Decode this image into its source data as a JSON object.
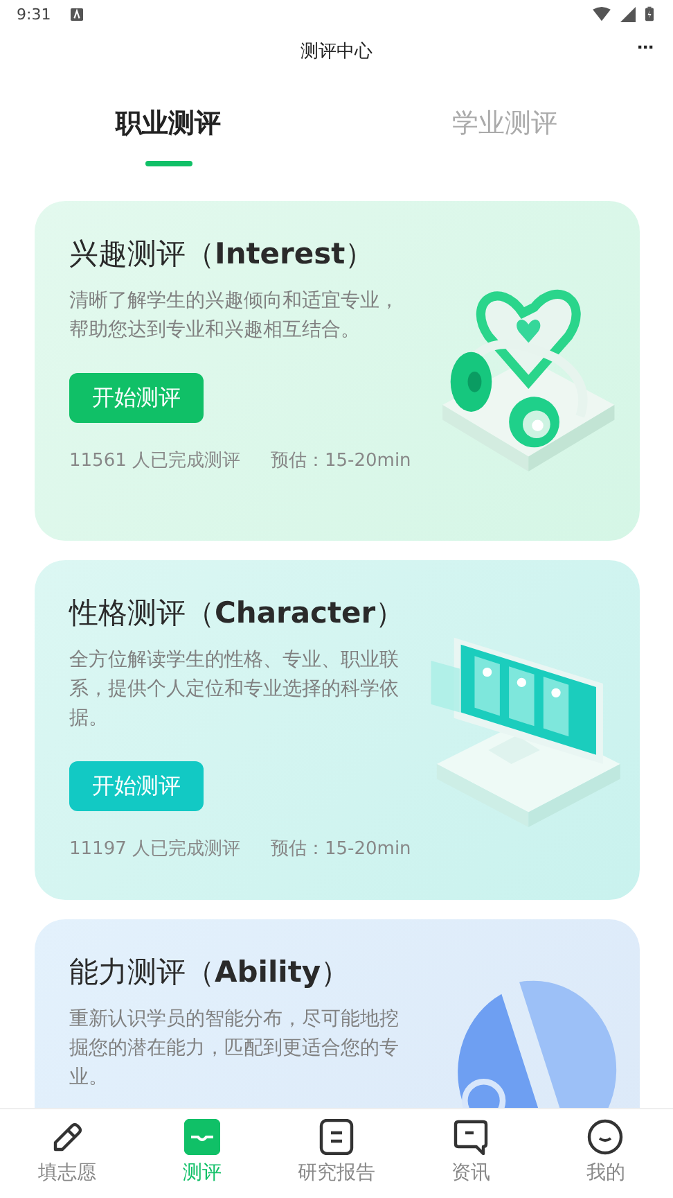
{
  "status_bar": {
    "time": "9:31"
  },
  "header": {
    "title": "测评中心",
    "more": "···"
  },
  "tabs": [
    {
      "label": "职业测评",
      "selected": true
    },
    {
      "label": "学业测评",
      "selected": false
    }
  ],
  "cards": [
    {
      "kind": "interest",
      "title": "兴趣测评（",
      "title_en": "Interest",
      "title_end": "）",
      "description": "清晰了解学生的兴趣倾向和适宜专业，帮助您达到专业和兴趣相互结合。",
      "button": "开始测评",
      "count": "11561 人已完成测评",
      "estimate": "预估：15-20min"
    },
    {
      "kind": "character",
      "title": "性格测评（",
      "title_en": "Character",
      "title_end": "）",
      "description": "全方位解读学生的性格、专业、职业联系，提供个人定位和专业选择的科学依据。",
      "button": "开始测评",
      "count": "11197 人已完成测评",
      "estimate": "预估：15-20min"
    },
    {
      "kind": "ability",
      "title": "能力测评（",
      "title_en": "Ability",
      "title_end": "）",
      "description": "重新认识学员的智能分布，尽可能地挖掘您的潜在能力，匹配到更适合您的专业。"
    }
  ],
  "bottom_nav": [
    {
      "kind": "pencil",
      "label": "填志愿",
      "selected": false
    },
    {
      "kind": "wave",
      "label": "测评",
      "selected": true
    },
    {
      "kind": "report",
      "label": "研究报告",
      "selected": false
    },
    {
      "kind": "chat",
      "label": "资讯",
      "selected": false
    },
    {
      "kind": "smile",
      "label": "我的",
      "selected": false
    }
  ]
}
